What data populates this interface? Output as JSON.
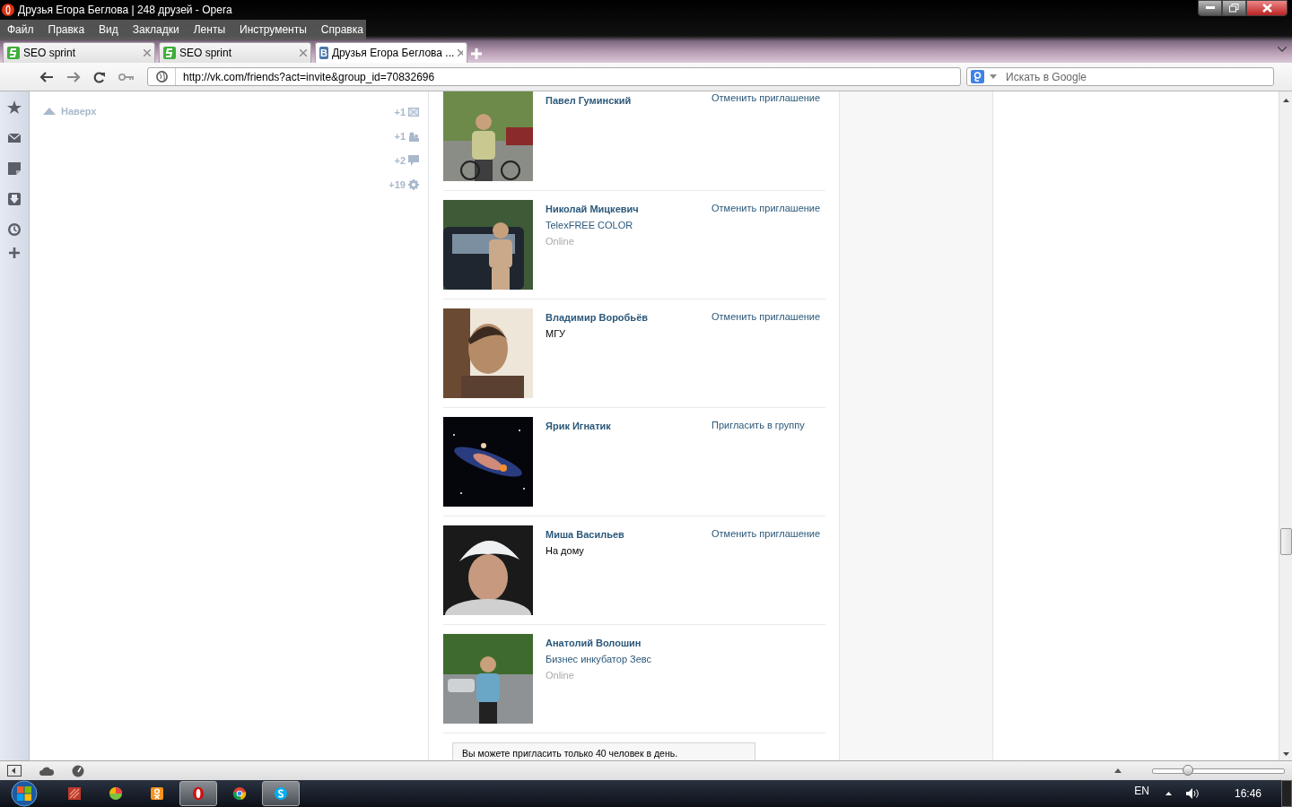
{
  "window": {
    "title": "Друзья Егора Беглова | 248 друзей - Opera"
  },
  "menu": [
    "Файл",
    "Правка",
    "Вид",
    "Закладки",
    "Ленты",
    "Инструменты",
    "Справка"
  ],
  "tabs": [
    {
      "label": "SEO sprint",
      "kind": "seo",
      "selected": false
    },
    {
      "label": "SEO sprint",
      "kind": "seo",
      "selected": false
    },
    {
      "label": "Друзья Егора Беглова ...",
      "kind": "vk",
      "icon_text": "B",
      "selected": true
    }
  ],
  "address": {
    "url": "http://vk.com/friends?act=invite&group_id=70832696"
  },
  "search": {
    "placeholder": "Искать в Google"
  },
  "left_column": {
    "top_link": "Наверх",
    "counters": [
      {
        "text": "+1",
        "kind": "mail"
      },
      {
        "text": "+1",
        "kind": "people"
      },
      {
        "text": "+2",
        "kind": "comment"
      },
      {
        "text": "+19",
        "kind": "gear"
      }
    ]
  },
  "friends": [
    {
      "name": "Павел Гуминский",
      "action": "Отменить приглашение"
    },
    {
      "name": "Николай Мицкевич",
      "subtitle": "TelexFREE COLOR",
      "subtitle_link": true,
      "status": "Online",
      "action": "Отменить приглашение"
    },
    {
      "name": "Владимир Воробьёв",
      "subtitle": "МГУ",
      "subtitle_link": false,
      "action": "Отменить приглашение"
    },
    {
      "name": "Ярик Игнатик",
      "action": "Пригласить в группу"
    },
    {
      "name": "Миша Васильев",
      "subtitle": "На дому",
      "subtitle_link": false,
      "action": "Отменить приглашение"
    },
    {
      "name": "Анатолий Волошин",
      "subtitle": "Бизнес инкубатор Зевс",
      "subtitle_link": true,
      "status": "Online"
    }
  ],
  "notice": "Вы можете пригласить только 40 человек в день.",
  "zoom": {
    "level": 0.27
  },
  "taskbar": {
    "apps": [
      {
        "kind": "red",
        "active": false
      },
      {
        "kind": "ball",
        "active": false
      },
      {
        "kind": "ok",
        "active": false
      },
      {
        "kind": "opera",
        "active": true
      },
      {
        "kind": "chrome",
        "active": false
      },
      {
        "kind": "skype",
        "active": true
      }
    ],
    "language": "EN",
    "time": "16:46"
  }
}
